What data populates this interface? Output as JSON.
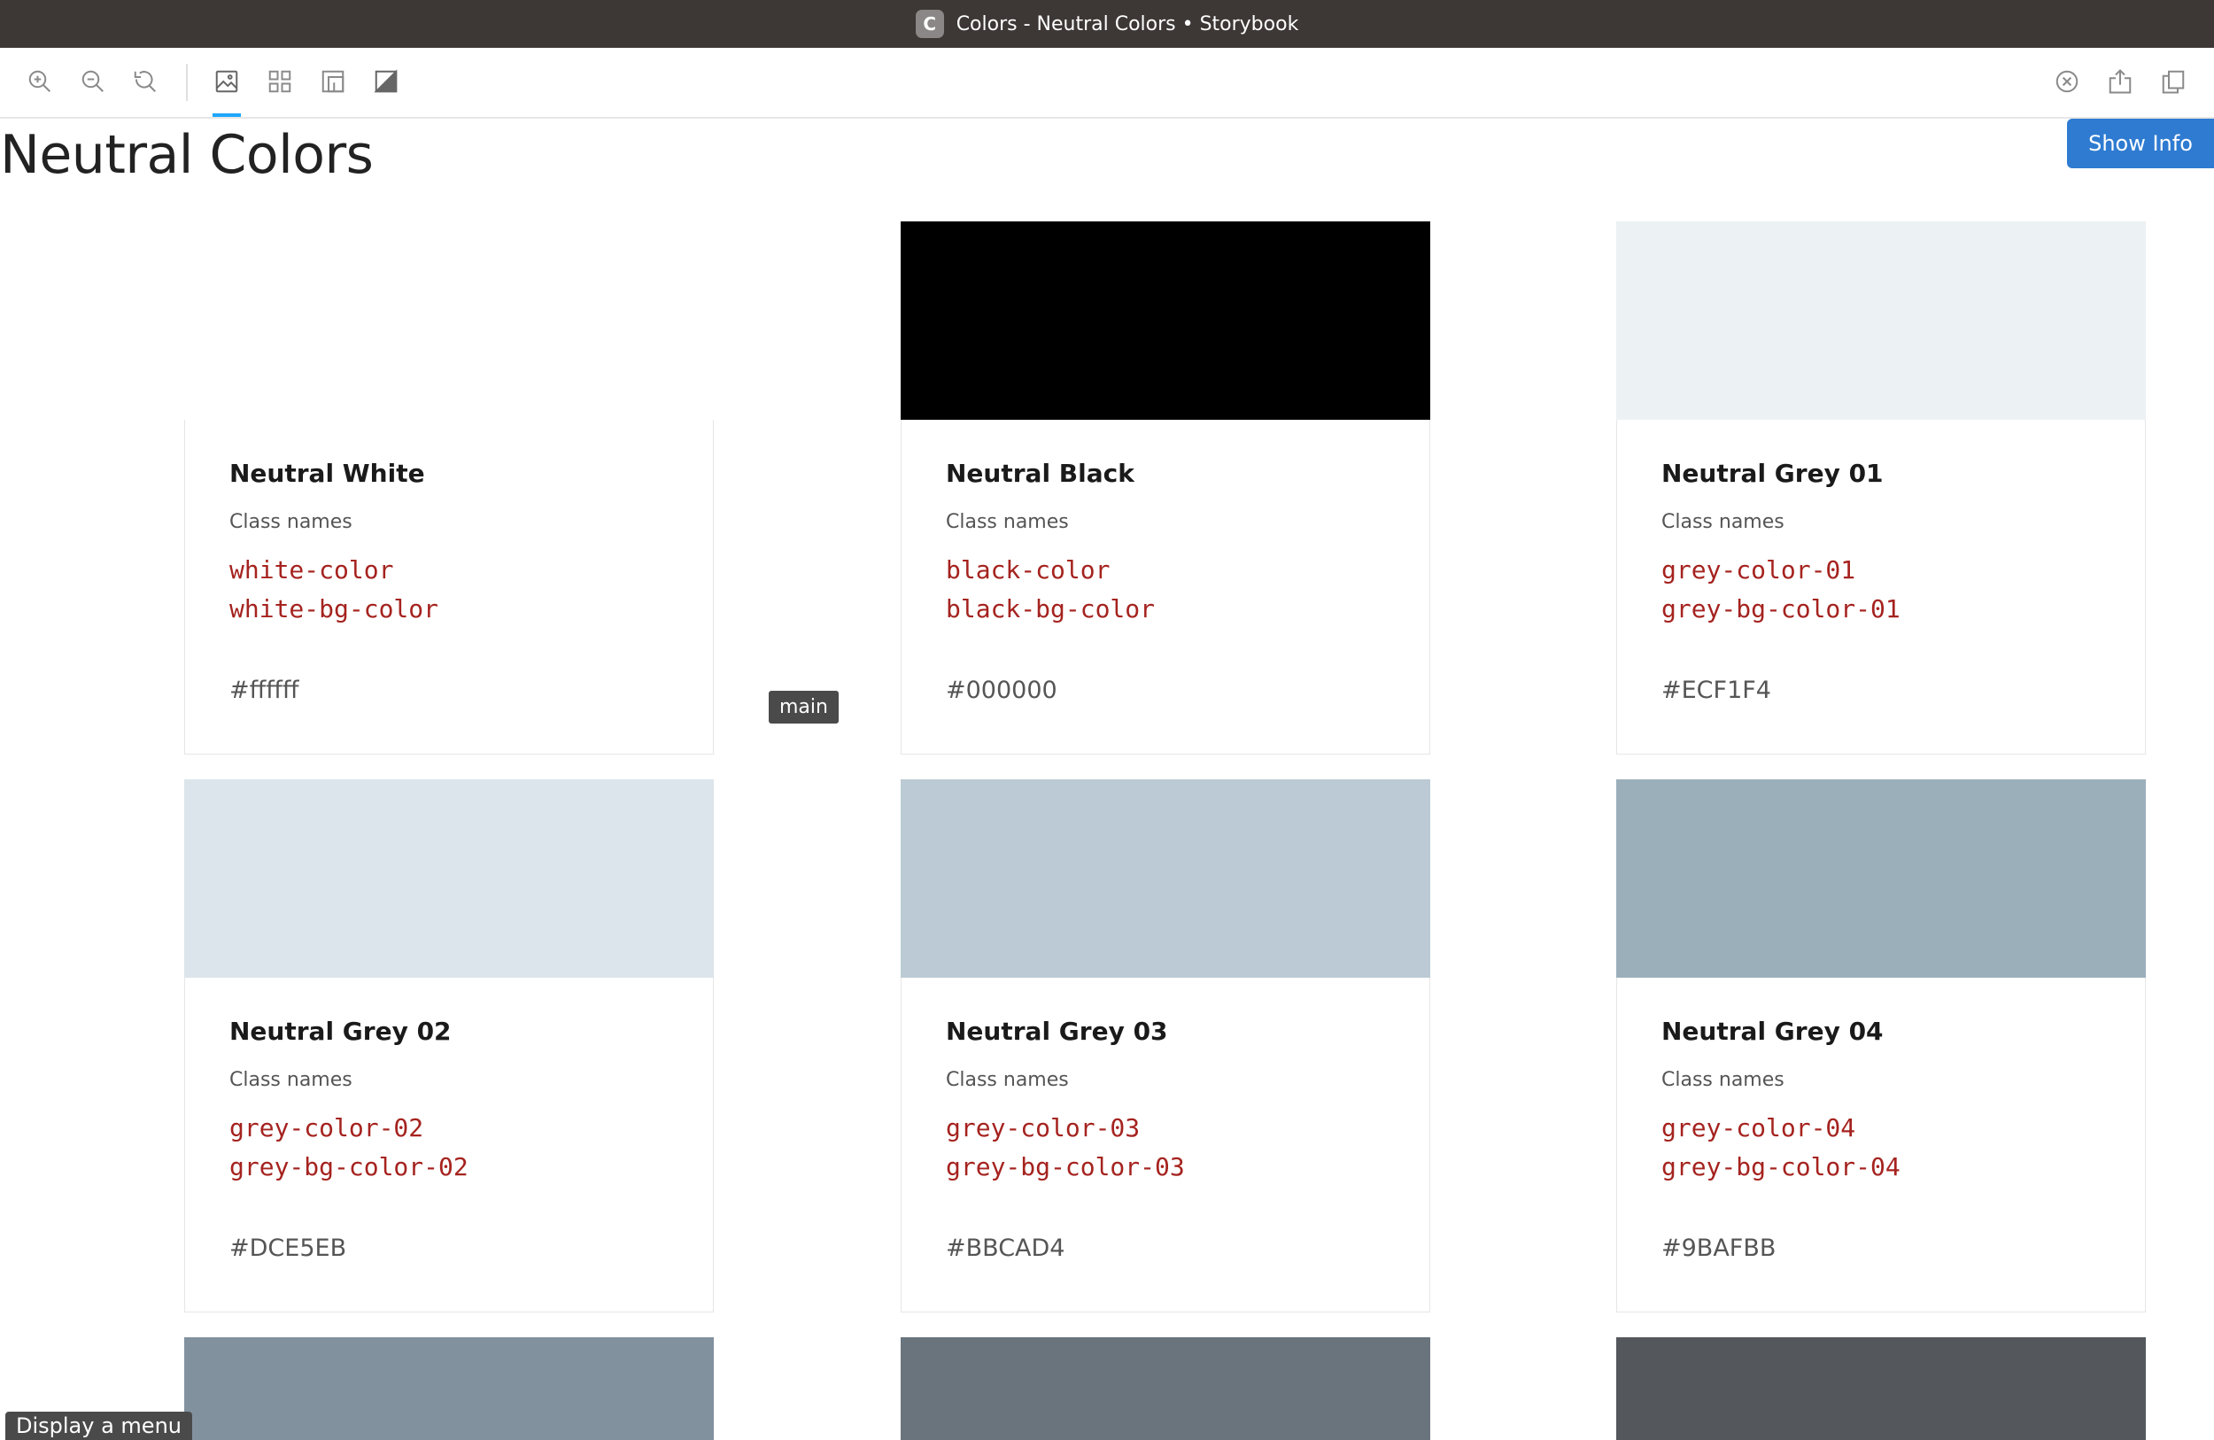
{
  "window": {
    "title": "Colors - Neutral Colors • Storybook",
    "app_icon_letter": "C"
  },
  "toolbar": {
    "left_icons": [
      "zoom-in-icon",
      "zoom-out-icon",
      "reset-zoom-icon",
      "image-icon",
      "grid-icon",
      "background-icon",
      "contrast-icon"
    ],
    "right_icons": [
      "close-circle-icon",
      "share-icon",
      "copy-icon"
    ]
  },
  "page": {
    "title": "Neutral Colors",
    "show_info_label": "Show Info",
    "tooltip": "main",
    "menu_hint": "Display a menu"
  },
  "cards": [
    {
      "name": "Neutral White",
      "class_label": "Class names",
      "class_1": "white-color",
      "class_2": "white-bg-color",
      "hex": "#ffffff",
      "swatch": "#ffffff"
    },
    {
      "name": "Neutral Black",
      "class_label": "Class names",
      "class_1": "black-color",
      "class_2": "black-bg-color",
      "hex": "#000000",
      "swatch": "#000000"
    },
    {
      "name": "Neutral Grey 01",
      "class_label": "Class names",
      "class_1": "grey-color-01",
      "class_2": "grey-bg-color-01",
      "hex": "#ECF1F4",
      "swatch": "#ECF1F4"
    },
    {
      "name": "Neutral Grey 02",
      "class_label": "Class names",
      "class_1": "grey-color-02",
      "class_2": "grey-bg-color-02",
      "hex": "#DCE5EB",
      "swatch": "#DCE5EB"
    },
    {
      "name": "Neutral Grey 03",
      "class_label": "Class names",
      "class_1": "grey-color-03",
      "class_2": "grey-bg-color-03",
      "hex": "#BBCAD4",
      "swatch": "#BBCAD4"
    },
    {
      "name": "Neutral Grey 04",
      "class_label": "Class names",
      "class_1": "grey-color-04",
      "class_2": "grey-bg-color-04",
      "hex": "#9BAFBB",
      "swatch": "#9BAFBB"
    }
  ],
  "partial_swatches": [
    "#82919e",
    "#69747d",
    "#54585c"
  ],
  "colors": {
    "accent": "#2e7bd1",
    "class_name_text": "#a5231f",
    "titlebar": "#3d3735"
  }
}
